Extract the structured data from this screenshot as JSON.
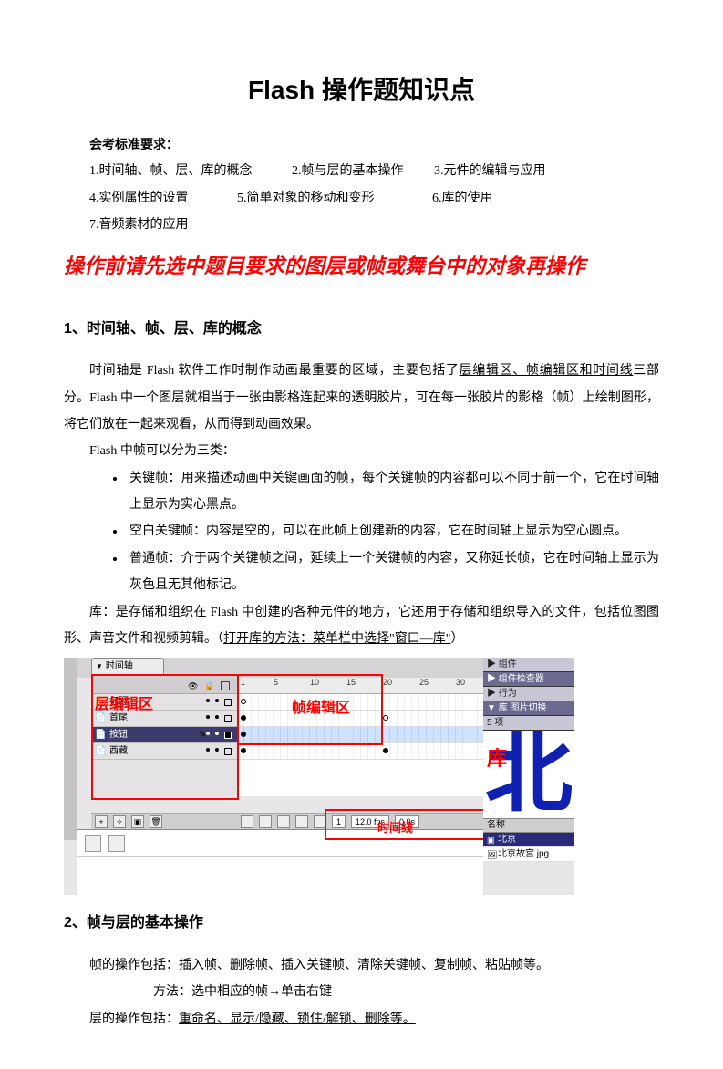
{
  "title": "Flash 操作题知识点",
  "subhead": "会考标准要求：",
  "reqs": {
    "r1": "1.时间轴、帧、层、库的概念",
    "r2": "2.帧与层的基本操作",
    "r3": "3.元件的编辑与应用",
    "r4": "4.实例属性的设置",
    "r5": "5.简单对象的移动和变形",
    "r6": "6.库的使用",
    "r7": "7.音频素材的应用"
  },
  "warning": "操作前请先选中题目要求的图层或帧或舞台中的对象再操作",
  "sec1": "1、时间轴、帧、层、库的概念",
  "p1a": "时间轴是 Flash 软件工作时制作动画最重要的区域，主要包括了",
  "p1a_u": "层编辑区、帧编辑区和时间线",
  "p1a2": "三部分。Flash 中一个图层就相当于一张由影格连起来的透明胶片，可在每一张胶片的影格（帧）上绘制图形，将它们放在一起来观看，从而得到动画效果。",
  "p_frames_intro": "Flash 中帧可以分为三类：",
  "bullets": {
    "b1": "关键帧：用来描述动画中关键画面的帧，每个关键帧的内容都可以不同于前一个，它在时间轴上显示为实心黑点。",
    "b2": "空白关键帧：内容是空的，可以在此帧上创建新的内容，它在时间轴上显示为空心圆点。",
    "b3": "普通帧：介于两个关键帧之间，延续上一个关键帧的内容，又称延长帧，它在时间轴上显示为灰色且无其他标记。"
  },
  "p_lib_a": "库：是存储和组织在 Flash 中创建的各种元件的地方，它还用于存储和组织导入的文件，包括位图图形、声音文件和视频剪辑。（",
  "p_lib_u": "打开库的方法：菜单栏中选择\"窗口—库\"",
  "p_lib_b": "）",
  "flash": {
    "timeline_tab": "时间轴",
    "layers": {
      "l1": "标题",
      "l2": "首尾",
      "l3": "按钮",
      "l4": "西藏"
    },
    "ruler": {
      "t1": "1",
      "t5": "5",
      "t10": "10",
      "t15": "15",
      "t20": "20",
      "t25": "25",
      "t30": "30"
    },
    "status": {
      "frame": "1",
      "fps": "12.0 fps",
      "time": "0.0s"
    },
    "labels": {
      "layer_area": "层编辑区",
      "frame_area": "帧编辑区",
      "timeline": "时间线",
      "library": "库"
    },
    "right": {
      "components": "▶ 组件",
      "compInspect": "▶ 组件检查器",
      "behaviors": "▶ 行为",
      "lib": "▼ 库  图片切换",
      "itemcount": "5 项",
      "preview_char": "北",
      "col_name": "名称",
      "row1": "北京",
      "row2": "北京故宫.jpg"
    }
  },
  "sec2": "2、帧与层的基本操作",
  "p2a_lead": "帧的操作包括：",
  "p2a_u": "插入帧、删除帧、插入关键帧、清除关键帧、复制帧、粘贴帧等。",
  "p2_method": "方法：选中相应的帧→单击右键",
  "p2b_lead": "层的操作包括：",
  "p2b_u": "重命名、显示/隐藏、锁住/解锁、删除等。"
}
